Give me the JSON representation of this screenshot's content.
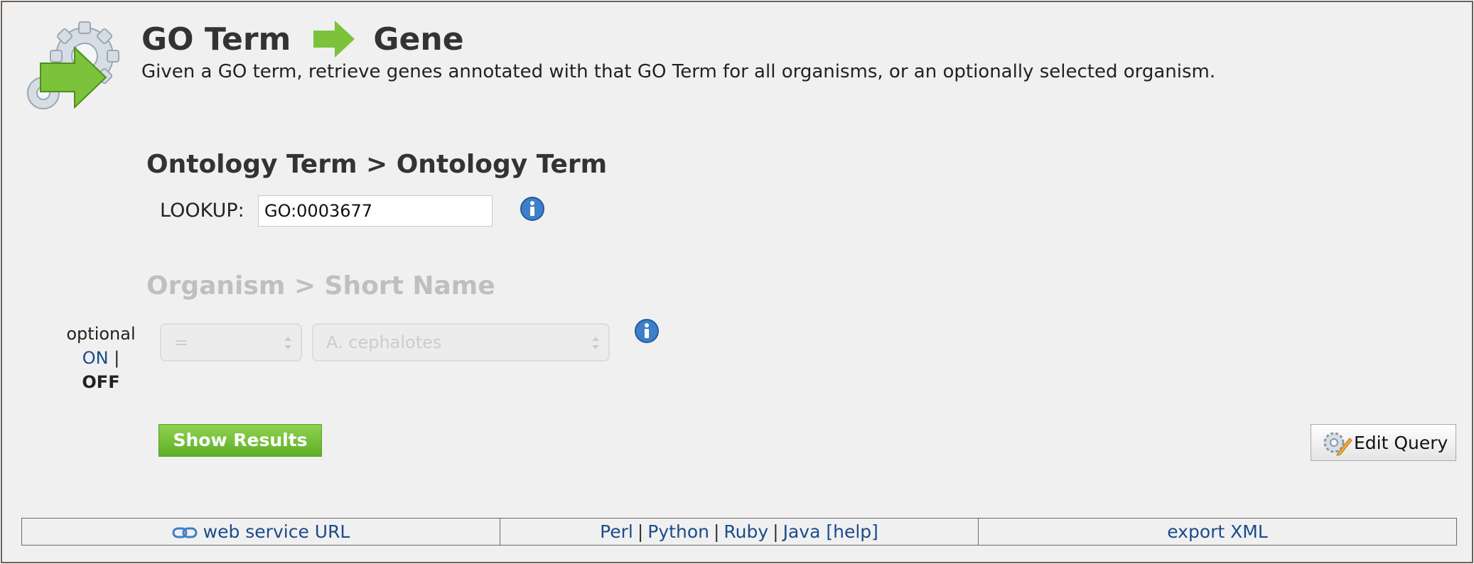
{
  "header": {
    "title_from": "GO Term",
    "title_to": "Gene",
    "logo_icon": "gears-arrow-icon",
    "arrow_icon": "green-arrow-right-icon",
    "description": "Given a GO term, retrieve genes annotated with that GO Term for all organisms, or an optionally selected organism."
  },
  "constraint1": {
    "heading": "Ontology Term > Ontology Term",
    "label": "LOOKUP:",
    "value": "GO:0003677",
    "info_icon": "info-icon"
  },
  "constraint2": {
    "heading": "Organism > Short Name",
    "optional_label": "optional",
    "on_label": "ON",
    "separator": "|",
    "off_label": "OFF",
    "operator": "=",
    "value": "A. cephalotes",
    "enabled": false,
    "info_icon": "info-icon"
  },
  "actions": {
    "show_results": "Show Results",
    "edit_query": "Edit Query",
    "edit_icon": "gear-pencil-icon"
  },
  "footer": {
    "web_service": "web service URL",
    "link_icon": "chain-link-icon",
    "perl": "Perl",
    "python": "Python",
    "ruby": "Ruby",
    "java": "Java",
    "help": "[help]",
    "separator": "|",
    "export": "export XML"
  },
  "colors": {
    "background": "#f0f0f0",
    "link": "#1a4b8c",
    "button_green": "#6cbf35",
    "disabled_text": "#bfbfbf"
  }
}
